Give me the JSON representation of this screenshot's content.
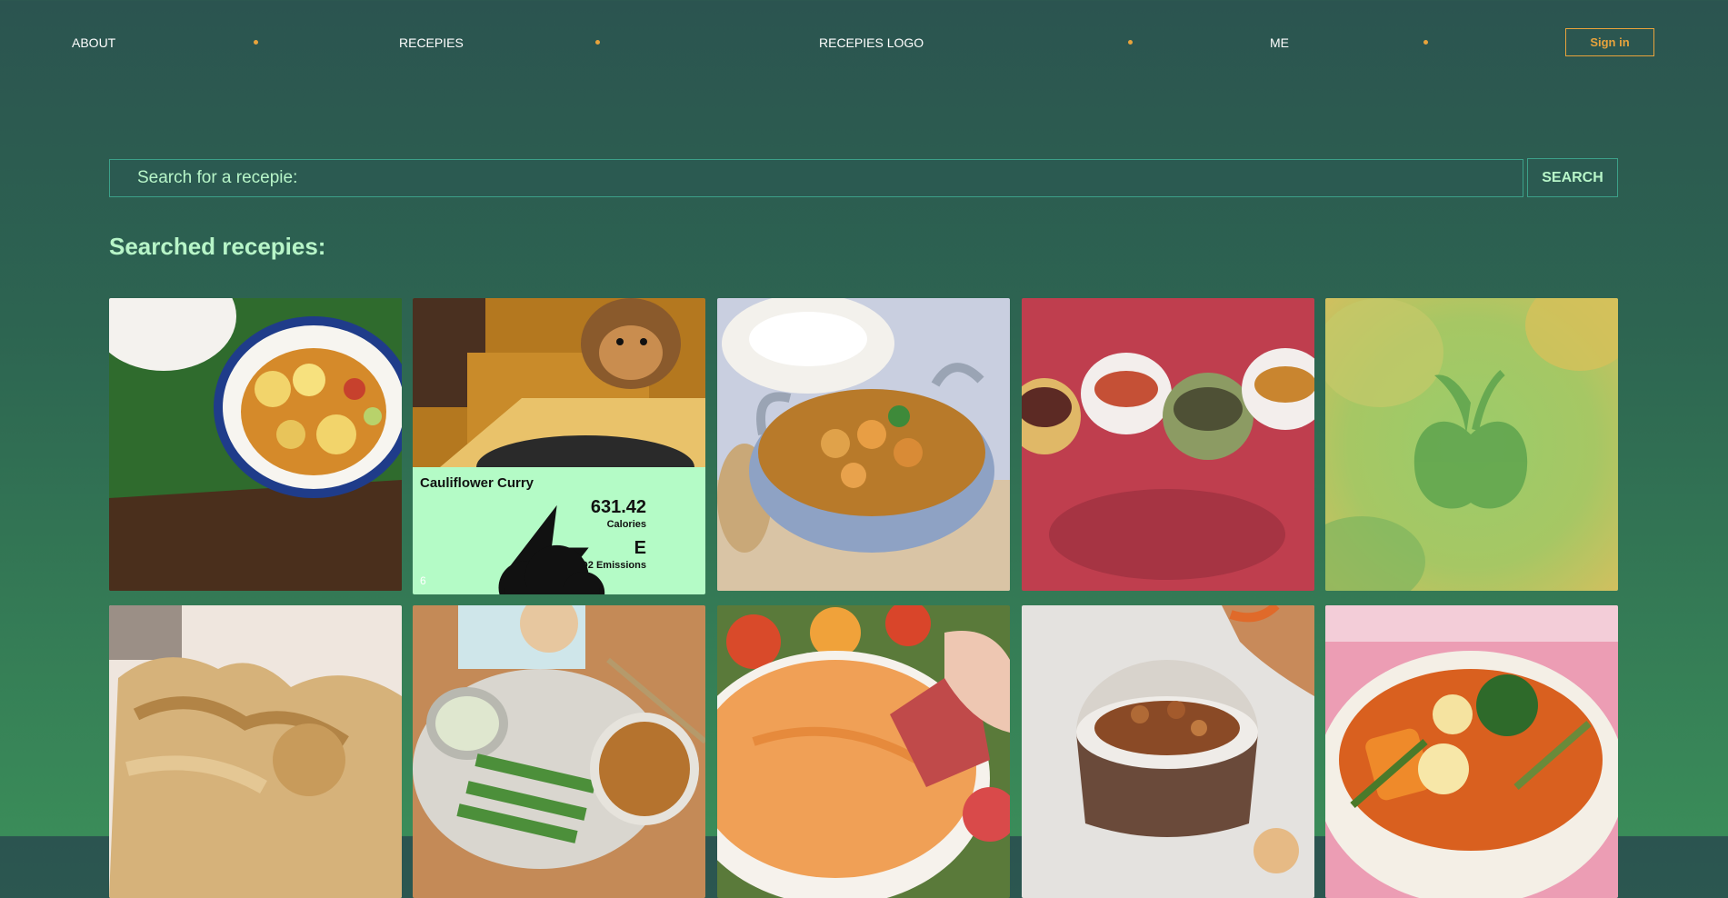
{
  "nav": {
    "about": "ABOUT",
    "recipes": "RECEPIES",
    "logo": "RECEPIES LOGO",
    "me": "ME",
    "signin": "Sign in"
  },
  "search": {
    "placeholder": "Search for a recepie:",
    "button": "SEARCH"
  },
  "results": {
    "heading": "Searched recepies:",
    "featured": {
      "title": "Cauliflower Curry",
      "calories_value": "631.42",
      "calories_label": "Calories",
      "co2_value": "E",
      "co2_label": "CO2 Emissions",
      "rank": "6",
      "calories_icon": "lightning-icon",
      "co2_icon": "cloud-emission-icon"
    },
    "cards": [
      {
        "image": "cauliflower-curry-bowl"
      },
      {
        "image": "dog-kitchen"
      },
      {
        "image": "prawn-curry-balti"
      },
      {
        "image": "spice-bowls"
      },
      {
        "image": "placeholder-apple"
      },
      {
        "image": "pastry"
      },
      {
        "image": "cucumber-chickpeas"
      },
      {
        "image": "hummus-dip"
      },
      {
        "image": "spiced-nuts"
      },
      {
        "image": "vegetable-stew"
      }
    ]
  },
  "colors": {
    "accent": "#e8a33c",
    "mint": "#b7f5c8",
    "card_info": "#b4fbc6"
  }
}
